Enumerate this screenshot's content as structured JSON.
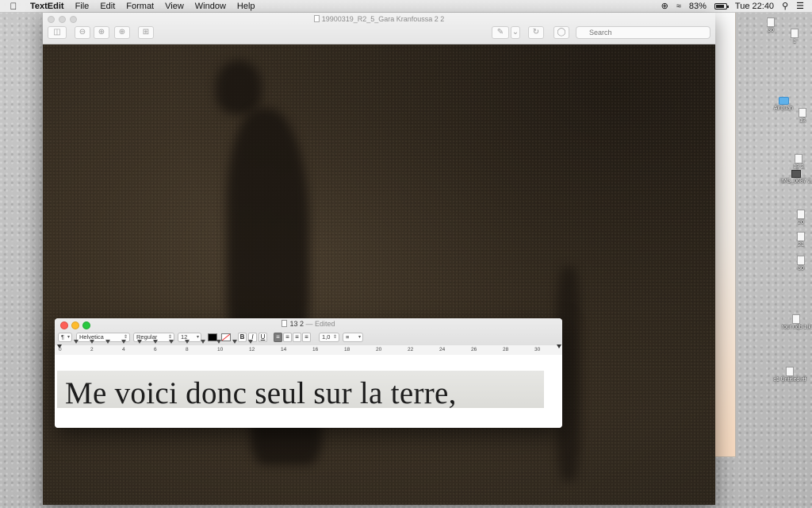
{
  "menubar": {
    "app_name": "TextEdit",
    "items": [
      "File",
      "Edit",
      "Format",
      "View",
      "Window",
      "Help"
    ],
    "battery_percent": "83%",
    "clock": "Tue 22:40"
  },
  "preview": {
    "title": "19900319_R2_5_Gara Kranfoussa 2 2",
    "search_placeholder": "Search"
  },
  "textedit": {
    "title": "13 2",
    "edited_suffix": "— Edited",
    "paragraph_style": "¶",
    "font_family": "Helvetica",
    "font_style": "Regular",
    "font_size": "12",
    "bold_label": "B",
    "italic_label": "I",
    "underline_label": "U",
    "line_spacing": "1,0",
    "ruler_numbers": [
      "0",
      "2",
      "4",
      "6",
      "8",
      "10",
      "12",
      "14",
      "16",
      "18",
      "20",
      "22",
      "24",
      "26",
      "28",
      "30"
    ],
    "document_text": "Me voici donc seul sur la terre,"
  },
  "desktop_icons": [
    {
      "label": "30",
      "icon": "document-icon"
    },
    {
      "label": "1",
      "icon": "document-icon"
    },
    {
      "label": "Airouan",
      "icon": "folder-icon"
    },
    {
      "label": "13",
      "icon": "document-icon"
    },
    {
      "label": "13 2",
      "icon": "document-icon"
    },
    {
      "label": "IMG_0687 2.HEIC",
      "icon": "image-icon"
    },
    {
      "label": "20",
      "icon": "document-icon"
    },
    {
      "label": "21",
      "icon": "document-icon"
    },
    {
      "label": "30",
      "icon": "document-icon"
    },
    {
      "label": "tour uqb 1.kmz",
      "icon": "document-icon"
    },
    {
      "label": "c1 Untitled.rtf",
      "icon": "document-icon"
    }
  ]
}
